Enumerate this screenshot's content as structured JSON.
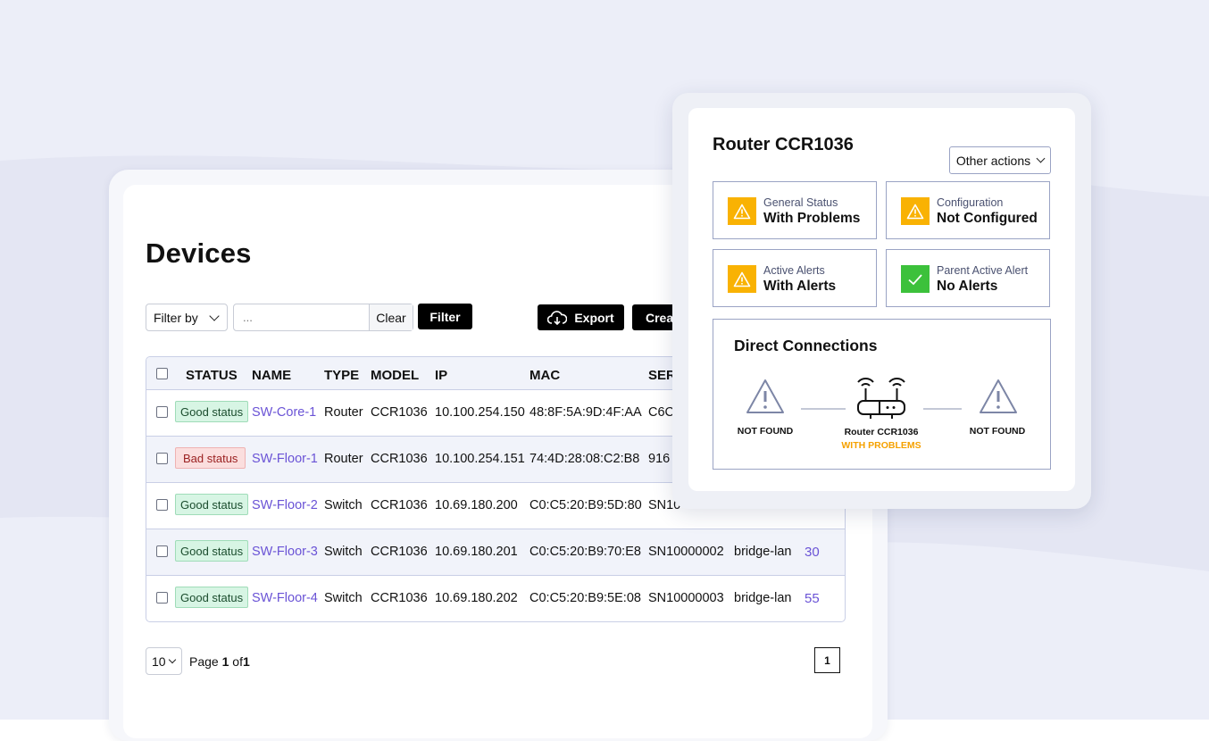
{
  "page": {
    "title": "Devices"
  },
  "toolbar": {
    "filter_by_label": "Filter by",
    "search_placeholder": "...",
    "clear_label": "Clear",
    "filter_label": "Filter",
    "export_label": "Export",
    "create_label": "Crea"
  },
  "table": {
    "headers": [
      "STATUS",
      "NAME",
      "TYPE",
      "MODEL",
      "IP",
      "MAC",
      "SER"
    ],
    "rows": [
      {
        "status": "Good status",
        "name": "SW-Core-1",
        "type": "Router",
        "model": "CCR1036",
        "ip": "10.100.254.150",
        "mac": "48:8F:5A:9D:4F:AA",
        "serial": "C6C",
        "interface": "",
        "count": ""
      },
      {
        "status": "Bad status",
        "name": "SW-Floor-1",
        "type": "Router",
        "model": "CCR1036",
        "ip": "10.100.254.151",
        "mac": "74:4D:28:08:C2:B8",
        "serial": "916",
        "interface": "",
        "count": ""
      },
      {
        "status": "Good status",
        "name": "SW-Floor-2",
        "type": "Switch",
        "model": "CCR1036",
        "ip": "10.69.180.200",
        "mac": "C0:C5:20:B9:5D:80",
        "serial": "SN10",
        "interface": "",
        "count": ""
      },
      {
        "status": "Good status",
        "name": "SW-Floor-3",
        "type": "Switch",
        "model": "CCR1036",
        "ip": "10.69.180.201",
        "mac": "C0:C5:20:B9:70:E8",
        "serial": "SN10000002",
        "interface": "bridge-lan",
        "count": "30"
      },
      {
        "status": "Good status",
        "name": "SW-Floor-4",
        "type": "Switch",
        "model": "CCR1036",
        "ip": "10.69.180.202",
        "mac": "C0:C5:20:B9:5E:08",
        "serial": "SN10000003",
        "interface": "bridge-lan",
        "count": "55"
      }
    ]
  },
  "pagination": {
    "per_page": "10",
    "page_prefix": "Page ",
    "page_current": "1",
    "page_of": " of",
    "page_total": "1",
    "page_button": "1"
  },
  "popup": {
    "title": "Router CCR1036",
    "other_actions_label": "Other actions",
    "stats": [
      {
        "label": "General Status",
        "value": "With Problems",
        "icon": "warning-icon"
      },
      {
        "label": "Configuration",
        "value": "Not Configured",
        "icon": "warning-icon"
      },
      {
        "label": "Active Alerts",
        "value": "With Alerts",
        "icon": "warning-icon"
      },
      {
        "label": "Parent Active Alert",
        "value": "No Alerts",
        "icon": "check-icon"
      }
    ],
    "connections": {
      "title": "Direct Connections",
      "left_label": "NOT FOUND",
      "center_label": "Router CCR1036",
      "center_status": "WITH PROBLEMS",
      "right_label": "NOT FOUND"
    }
  },
  "colors": {
    "link": "#6a53d6",
    "warning": "#f9b203",
    "ok": "#3cc13b",
    "problem_text": "#f5a100"
  }
}
